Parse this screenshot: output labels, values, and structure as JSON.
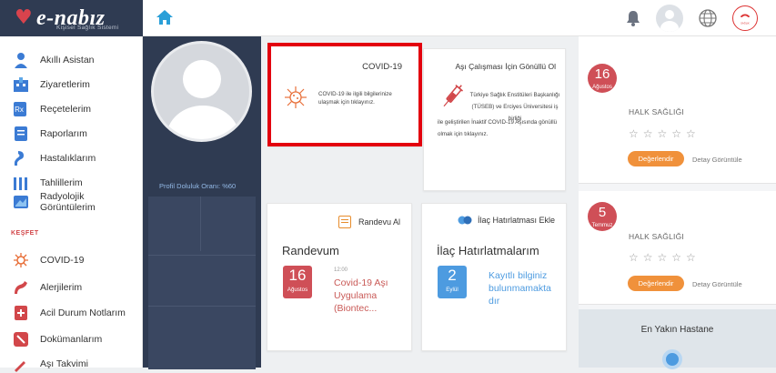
{
  "header": {
    "logo_text": "e-nabız",
    "logo_subtitle": "Kişisel Sağlık Sistemi",
    "gov_logo_text": "T.C. SAĞLIK BAKANLIĞI"
  },
  "sidebar": {
    "items": [
      {
        "label": "Akıllı Asistan",
        "icon": "assistant-icon",
        "color": "#3b7bd4"
      },
      {
        "label": "Ziyaretlerim",
        "icon": "hospital-icon",
        "color": "#3b7bd4"
      },
      {
        "label": "Reçetelerim",
        "icon": "prescription-icon",
        "color": "#3b7bd4"
      },
      {
        "label": "Raporlarım",
        "icon": "report-icon",
        "color": "#3b7bd4"
      },
      {
        "label": "Hastalıklarım",
        "icon": "disease-icon",
        "color": "#3b7bd4"
      },
      {
        "label": "Tahlillerim",
        "icon": "lab-test-icon",
        "color": "#3b7bd4"
      },
      {
        "label": "Radyolojik Görüntülerim",
        "icon": "radiology-icon",
        "color": "#3b7bd4"
      }
    ],
    "section_label": "KEŞFET",
    "explore_items": [
      {
        "label": "COVID-19",
        "icon": "virus-icon",
        "color": "#e8703a"
      },
      {
        "label": "Alerjilerim",
        "icon": "allergy-icon",
        "color": "#d2474a"
      },
      {
        "label": "Acil Durum Notlarım",
        "icon": "emergency-note-icon",
        "color": "#d2474a"
      },
      {
        "label": "Dokümanlarım",
        "icon": "document-icon",
        "color": "#d2474a"
      },
      {
        "label": "Aşı Takvimi",
        "icon": "vaccine-calendar-icon",
        "color": "#d2474a"
      }
    ]
  },
  "profile": {
    "completion_text": "Profil Doluluk Oranı: %60",
    "completion_percent": 60
  },
  "cards": {
    "covid": {
      "title": "COVID-19",
      "text": "COVID-19 ile ilgili bilgilerinize ulaşmak için tıklayınız."
    },
    "asi": {
      "title": "Aşı Çalışması İçin Gönüllü Ol",
      "text1": "Türkiye Sağlık Enstitüleri Başkanlığı (TÜSEB) ve Erciyes Üniversitesi iş birliği",
      "text2": "ile geliştirilen İnaktif COVID-19 Aşısında gönüllü olmak için tıklayınız."
    },
    "randevu": {
      "header": "Randevu Al",
      "subtitle": "Randevum",
      "day": "16",
      "month": "Ağustos",
      "time": "12:00",
      "text": "Covid-19 Aşı Uygulama (Biontec...",
      "badge_color": "#cf4f57"
    },
    "ilac": {
      "header": "İlaç Hatırlatması Ekle",
      "subtitle": "İlaç Hatırlatmalarım",
      "day": "2",
      "month": "Eylül",
      "text": "Kayıtlı bilginiz bulunmamakta dır",
      "badge_color": "#4d9be0"
    }
  },
  "right": {
    "items": [
      {
        "day": "16",
        "month": "Ağustos",
        "title": "HALK SAĞLIĞI",
        "stars": "☆☆☆☆☆",
        "button": "Değerlendir",
        "detail": "Detay Görüntüle"
      },
      {
        "day": "5",
        "month": "Temmuz",
        "title": "HALK SAĞLIĞI",
        "stars": "☆☆☆☆☆",
        "button": "Değerlendir",
        "detail": "Detay Görüntüle"
      }
    ],
    "hospital_title": "En Yakın Hastane"
  }
}
